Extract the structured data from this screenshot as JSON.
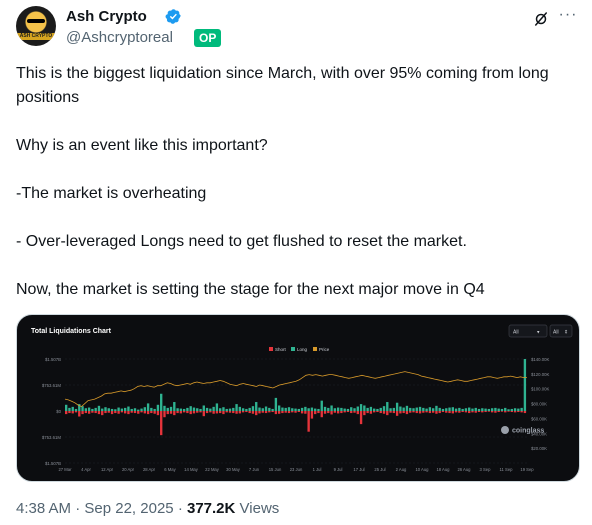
{
  "author": {
    "name": "Ash Crypto",
    "handle": "@Ashcryptoreal",
    "badge": "OP",
    "avatar_text": "ASH CRYPTO"
  },
  "tweet": {
    "paragraphs": [
      "This is the biggest liquidation since March, with over 95% coming from long positions",
      "Why is an event like this important?",
      "-The market is overheating",
      "- Over-leveraged Longs need to get flushed to reset the market.",
      "Now, the market is setting the stage for the next major move in Q4"
    ]
  },
  "meta": {
    "time": "4:38 AM",
    "date": "Sep 22, 2025",
    "separator": "·",
    "views_count": "377.2K",
    "views_label": "Views"
  },
  "colors": {
    "short": "#e5343b",
    "long": "#2fb391",
    "price": "#d89a2a",
    "verified": "#1d9bf0",
    "op_badge": "#00ba7c"
  },
  "chart_data": {
    "type": "bar",
    "title": "Total Liquidations Chart",
    "controls": {
      "select_left": "All",
      "select_right": "All"
    },
    "legend": [
      "Short",
      "Long",
      "Price"
    ],
    "left_ticks": [
      "$1.507B",
      "$753.61M",
      "$0",
      "$753.61M",
      "$1.507B"
    ],
    "right_ticks": [
      "$140.00K",
      "$120.00K",
      "$100.00K",
      "$80.00K",
      "$60.00K",
      "$40.00K",
      "$20.00K"
    ],
    "x_ticks": [
      "27 Mar",
      "4 Apr",
      "12 Apr",
      "20 Apr",
      "28 Apr",
      "6 May",
      "14 May",
      "22 May",
      "30 May",
      "7 Jun",
      "15 Jun",
      "23 Jun",
      "1 Jul",
      "9 Jul",
      "17 Jul",
      "25 Jul",
      "2 Aug",
      "10 Aug",
      "18 Aug",
      "26 Aug",
      "3 Sep",
      "11 Sep",
      "19 Sep"
    ],
    "watermark": "coinglass",
    "ylim_left": [
      -1507,
      1507
    ],
    "ylim_right": [
      0,
      140000
    ],
    "long_values": [
      180,
      90,
      120,
      60,
      200,
      140,
      80,
      100,
      60,
      90,
      150,
      70,
      110,
      80,
      60,
      50,
      100,
      70,
      90,
      130,
      60,
      80,
      40,
      70,
      110,
      220,
      90,
      60,
      180,
      500,
      150,
      90,
      120,
      260,
      80,
      70,
      60,
      90,
      140,
      100,
      80,
      60,
      160,
      90,
      70,
      120,
      220,
      80,
      110,
      60,
      70,
      90,
      200,
      120,
      80,
      60,
      90,
      140,
      260,
      100,
      80,
      130,
      90,
      60,
      380,
      160,
      100,
      90,
      110,
      80,
      70,
      60,
      90,
      120,
      80,
      100,
      70,
      60,
      300,
      120,
      90,
      160,
      80,
      100,
      90,
      70,
      60,
      110,
      80,
      130,
      200,
      160,
      90,
      120,
      70,
      60,
      90,
      140,
      260,
      80,
      90,
      240,
      130,
      100,
      150,
      90,
      80,
      100,
      120,
      90,
      70,
      110,
      80,
      150,
      90,
      60,
      80,
      100,
      110,
      70,
      90,
      60,
      80,
      100,
      70,
      90,
      60,
      80,
      70,
      60,
      80,
      90,
      70,
      60,
      90,
      50,
      60,
      80,
      70,
      90,
      1507
    ],
    "short_values": [
      90,
      60,
      70,
      40,
      160,
      90,
      60,
      80,
      50,
      60,
      90,
      120,
      60,
      50,
      90,
      60,
      80,
      40,
      70,
      90,
      50,
      60,
      80,
      40,
      70,
      90,
      60,
      80,
      120,
      700,
      180,
      90,
      80,
      120,
      60,
      70,
      40,
      60,
      90,
      70,
      50,
      40,
      150,
      60,
      40,
      80,
      70,
      60,
      90,
      40,
      50,
      60,
      80,
      70,
      40,
      30,
      60,
      80,
      120,
      70,
      50,
      60,
      40,
      30,
      90,
      80,
      60,
      50,
      60,
      40,
      50,
      30,
      70,
      80,
      600,
      220,
      90,
      60,
      180,
      80,
      60,
      100,
      50,
      70,
      60,
      40,
      30,
      60,
      50,
      90,
      380,
      120,
      60,
      80,
      40,
      30,
      60,
      80,
      120,
      50,
      60,
      140,
      70,
      60,
      90,
      50,
      40,
      60,
      70,
      50,
      40,
      60,
      50,
      80,
      60,
      30,
      50,
      60,
      70,
      40,
      50,
      30,
      40,
      60,
      40,
      50,
      30,
      40,
      30,
      20,
      40,
      50,
      30,
      20,
      40,
      20,
      30,
      40,
      30,
      40,
      60
    ],
    "price_values": [
      86000,
      85000,
      83000,
      81000,
      78000,
      76000,
      80000,
      84000,
      85000,
      86000,
      88000,
      90000,
      93000,
      94000,
      94000,
      95000,
      96000,
      97000,
      96000,
      97000,
      98000,
      100000,
      103000,
      104000,
      103000,
      104000,
      103000,
      102000,
      104000,
      104000,
      106000,
      108000,
      107000,
      105000,
      104000,
      105000,
      106000,
      107000,
      106000,
      108000,
      109000,
      108000,
      107000,
      108000,
      108000,
      109000,
      110000,
      111000,
      110000,
      108000,
      106000,
      105000,
      104000,
      106000,
      107000,
      106000,
      105000,
      104000,
      103000,
      105000,
      104000,
      103000,
      102000,
      101000,
      103000,
      105000,
      106000,
      107000,
      108000,
      109000,
      110000,
      112000,
      115000,
      118000,
      119000,
      118000,
      119000,
      118000,
      117000,
      118000,
      119000,
      119000,
      118000,
      117000,
      116000,
      115000,
      114000,
      115000,
      116000,
      117000,
      118000,
      117000,
      116000,
      115000,
      114000,
      115000,
      116000,
      117000,
      118000,
      119000,
      120000,
      121000,
      122000,
      123000,
      122000,
      121000,
      120000,
      119000,
      117000,
      116000,
      115000,
      114000,
      113000,
      112000,
      111000,
      110000,
      109000,
      110000,
      111000,
      112000,
      111000,
      110000,
      110000,
      111000,
      112000,
      113000,
      114000,
      115000,
      116000,
      116000,
      115000,
      114000,
      115000,
      116000,
      116000,
      117000,
      116000,
      115000,
      116000,
      115000,
      115000
    ]
  }
}
